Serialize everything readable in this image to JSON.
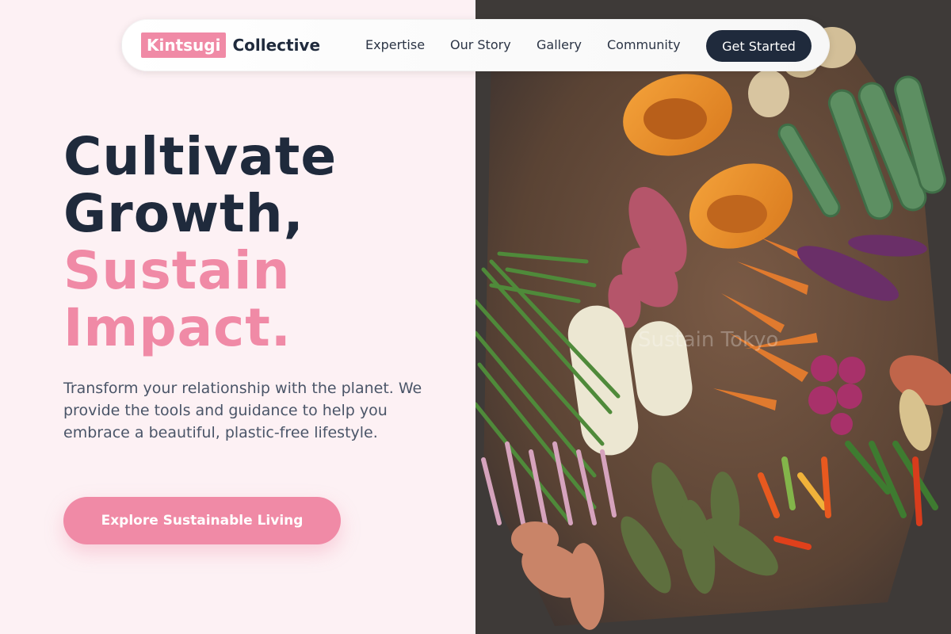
{
  "nav": {
    "brand_highlight": "Kintsugi",
    "brand_rest": "Collective",
    "links": [
      "Expertise",
      "Our Story",
      "Gallery",
      "Community"
    ],
    "cta": "Get Started"
  },
  "hero": {
    "heading_line1": "Cultivate",
    "heading_line2": "Growth,",
    "heading_line3": "Sustain",
    "heading_line4": "Impact.",
    "description": "Transform your relationship with the planet. We provide the tools and guidance to help you embrace a beautiful, plastic-free lifestyle.",
    "cta": "Explore Sustainable Living"
  },
  "photo": {
    "watermark": "Sustain Tokyo"
  },
  "colors": {
    "accent_pink": "#f08aa6",
    "navy": "#1f2a3c",
    "page_background": "#fdf1f4"
  }
}
